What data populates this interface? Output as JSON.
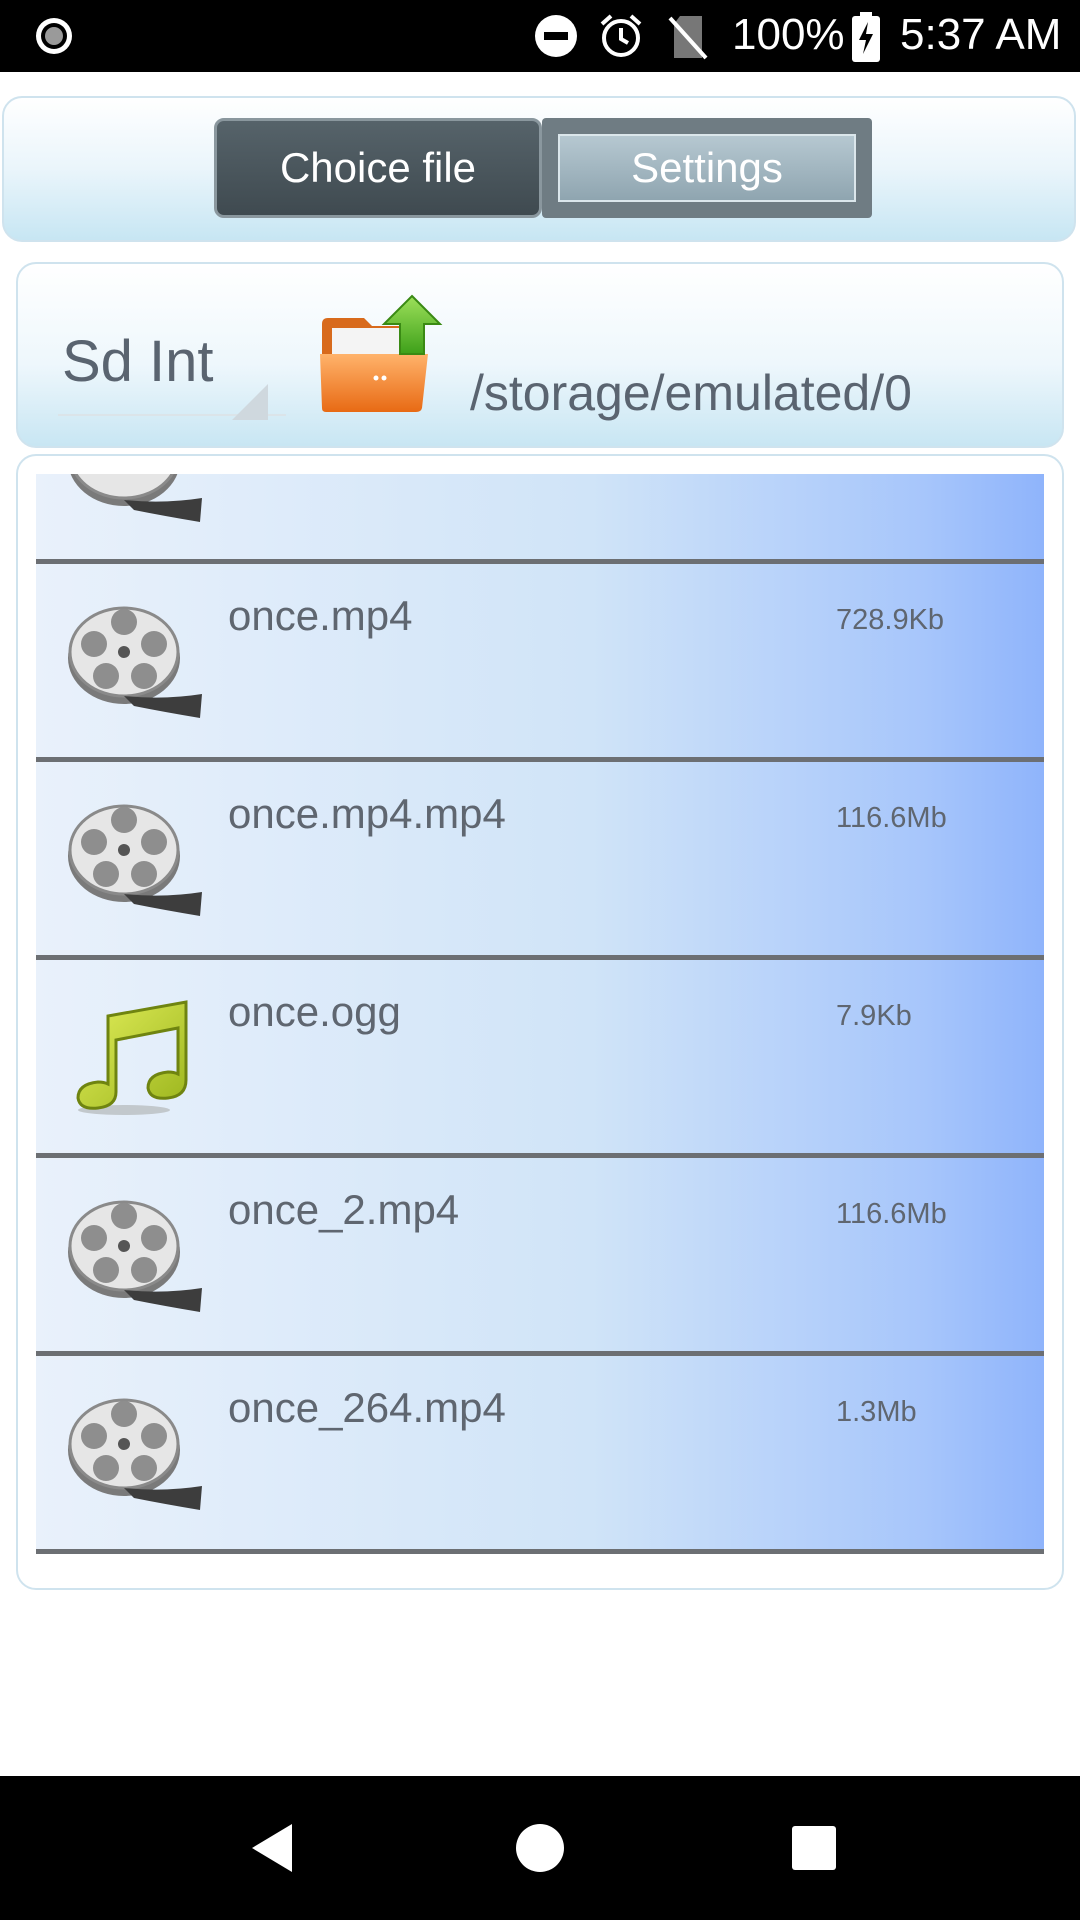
{
  "status_bar": {
    "battery_percent": "100%",
    "time": "5:37 AM",
    "icons": [
      "record-icon",
      "do-not-disturb-icon",
      "alarm-icon",
      "no-sim-icon",
      "battery-charging-icon"
    ]
  },
  "tabs": [
    {
      "label": "Choice file",
      "active": true
    },
    {
      "label": "Settings",
      "active": false
    }
  ],
  "location": {
    "drive": "Sd Int",
    "path": "/storage/emulated/0",
    "icon": "folder-up-icon"
  },
  "files": [
    {
      "name": "",
      "size": "",
      "type": "video",
      "icon": "film-reel-icon"
    },
    {
      "name": "once.mp4",
      "size": "728.9Kb",
      "type": "video",
      "icon": "film-reel-icon"
    },
    {
      "name": "once.mp4.mp4",
      "size": "116.6Mb",
      "type": "video",
      "icon": "film-reel-icon"
    },
    {
      "name": "once.ogg",
      "size": "7.9Kb",
      "type": "audio",
      "icon": "music-note-icon"
    },
    {
      "name": "once_2.mp4",
      "size": "116.6Mb",
      "type": "video",
      "icon": "film-reel-icon"
    },
    {
      "name": "once_264.mp4",
      "size": "1.3Mb",
      "type": "video",
      "icon": "film-reel-icon"
    }
  ],
  "nav": [
    "back-icon",
    "home-icon",
    "recents-icon"
  ],
  "colors": {
    "accent_row_end": "#8fb4fb",
    "tab_active": "#3f4a50",
    "tab_inactive": "#8fa5b0",
    "text": "#5f6670"
  }
}
